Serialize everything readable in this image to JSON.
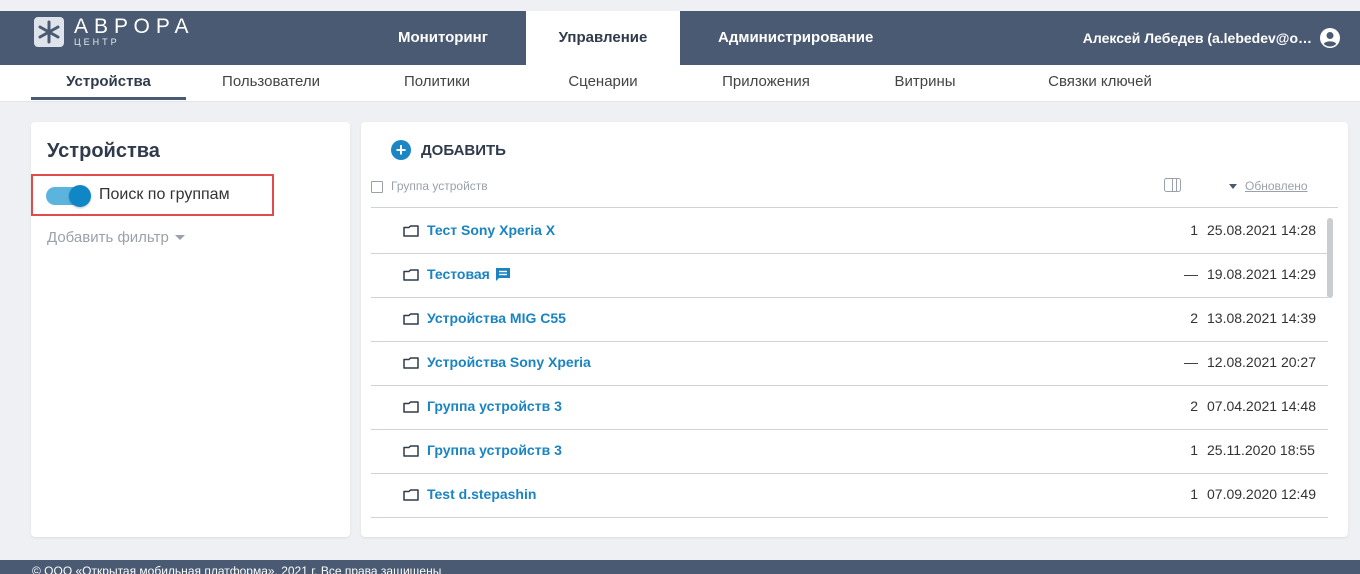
{
  "brand": {
    "title": "АВРОРА",
    "subtitle": "ЦЕНТР"
  },
  "top_nav": {
    "tabs": [
      {
        "label": "Мониторинг"
      },
      {
        "label": "Управление"
      },
      {
        "label": "Администрирование"
      }
    ],
    "active_tab": "Управление",
    "user": "Алексей Лебедев (a.lebedev@o…"
  },
  "sub_nav": {
    "tabs": [
      {
        "label": "Устройства"
      },
      {
        "label": "Пользователи"
      },
      {
        "label": "Политики"
      },
      {
        "label": "Сценарии"
      },
      {
        "label": "Приложения"
      },
      {
        "label": "Витрины"
      },
      {
        "label": "Связки ключей"
      }
    ],
    "active_tab": "Устройства"
  },
  "filter_panel": {
    "title": "Устройства",
    "toggle_label": "Поиск по группам",
    "toggle_on": true,
    "add_filter": "Добавить фильтр"
  },
  "list": {
    "add_label": "ДОБАВИТЬ",
    "column_group": "Группа устройств",
    "column_updated": "Обновлено",
    "rows": [
      {
        "name": "Тест Sony Xperia X",
        "count": "1",
        "date": "25.08.2021 14:28",
        "comment": false
      },
      {
        "name": "Тестовая",
        "count": "—",
        "date": "19.08.2021 14:29",
        "comment": true
      },
      {
        "name": "Устройства MIG C55",
        "count": "2",
        "date": "13.08.2021 14:39",
        "comment": false
      },
      {
        "name": "Устройства Sony Xperia",
        "count": "—",
        "date": "12.08.2021 20:27",
        "comment": false
      },
      {
        "name": "Группа устройств 3",
        "count": "2",
        "date": "07.04.2021 14:48",
        "comment": false
      },
      {
        "name": "Группа устройств 3",
        "count": "1",
        "date": "25.11.2020 18:55",
        "comment": false
      },
      {
        "name": "Test d.stepashin",
        "count": "1",
        "date": "07.09.2020 12:49",
        "comment": false
      }
    ]
  },
  "footer": {
    "text": "© ООО «Открытая мобильная платформа», 2021 г. Все права защищены"
  },
  "colors": {
    "header": "#4a5a72",
    "accent": "#1a84c2",
    "highlight_border": "#e24b4b"
  }
}
